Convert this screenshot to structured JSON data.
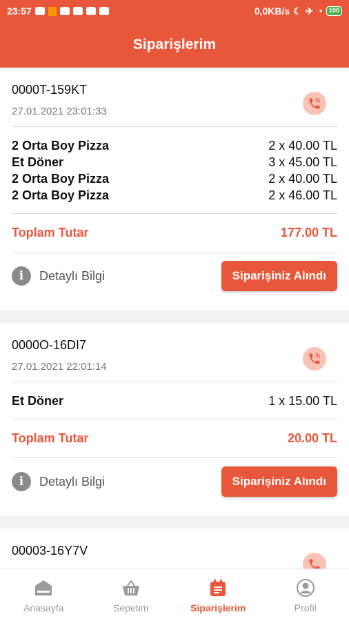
{
  "status_bar": {
    "time": "23:57",
    "network": "0,0KB/s",
    "battery": "100"
  },
  "app_bar": {
    "title": "Siparişlerim"
  },
  "orders": [
    {
      "id": "0000T-159KT",
      "date": "27.01.2021 23:01:33",
      "items": [
        {
          "name": "2 Orta Boy Pizza",
          "qty": "2 x 40.00 TL"
        },
        {
          "name": "Et Döner",
          "qty": "3 x 45.00 TL"
        },
        {
          "name": "2 Orta Boy Pizza",
          "qty": "2 x 40.00 TL"
        },
        {
          "name": "2 Orta Boy Pizza",
          "qty": "2 x 46.00 TL"
        }
      ],
      "total_label": "Toplam Tutar",
      "total_value": "177.00 TL",
      "info_label": "Detaylı Bilgi",
      "status_label": "Siparişiniz Alındı"
    },
    {
      "id": "0000O-16DI7",
      "date": "27.01.2021 22:01:14",
      "items": [
        {
          "name": "Et Döner",
          "qty": "1 x 15.00 TL"
        }
      ],
      "total_label": "Toplam Tutar",
      "total_value": "20.00 TL",
      "info_label": "Detaylı Bilgi",
      "status_label": "Siparişiniz Alındı"
    },
    {
      "id": "00003-16Y7V"
    }
  ],
  "bottom_nav": [
    {
      "label": "Anasayfa",
      "icon": "home-icon"
    },
    {
      "label": "Sepetim",
      "icon": "basket-icon"
    },
    {
      "label": "Siparişlerim",
      "icon": "orders-icon",
      "active": true
    },
    {
      "label": "Profil",
      "icon": "profile-icon"
    }
  ],
  "colors": {
    "accent": "#e9573a",
    "accent_light": "#f8c2b6",
    "muted": "#9a9a9a"
  }
}
